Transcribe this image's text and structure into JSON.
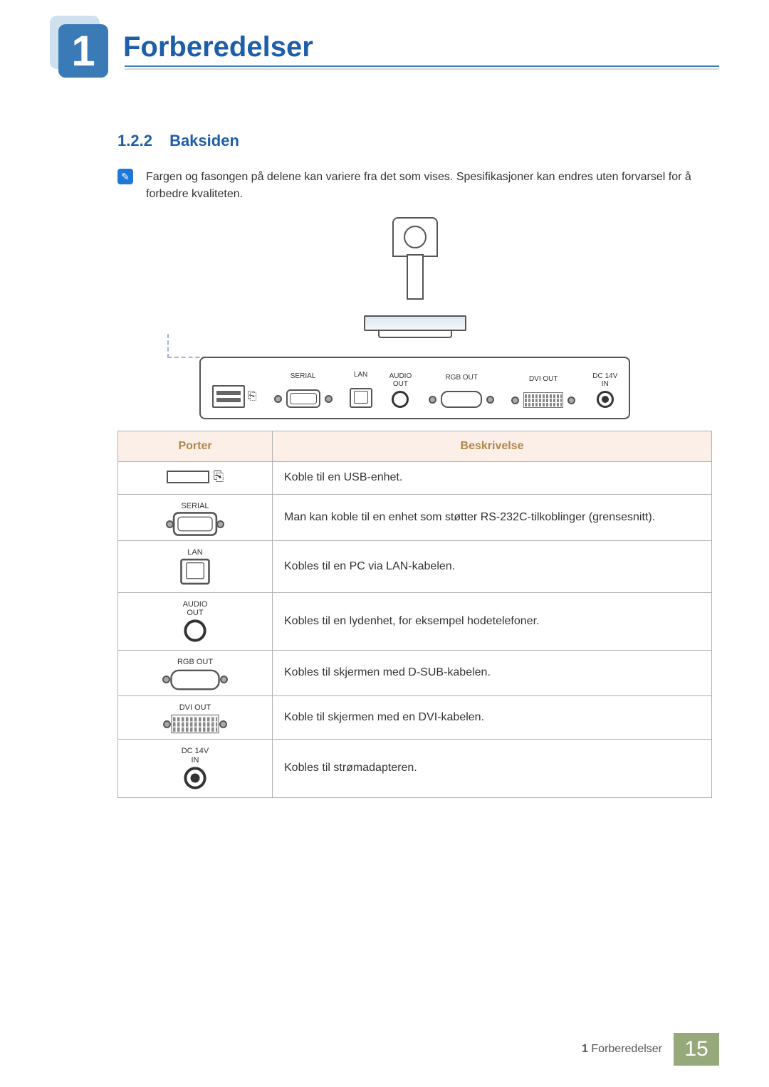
{
  "header": {
    "chapter_number": "1",
    "chapter_title": "Forberedelser"
  },
  "section": {
    "number": "1.2.2",
    "title": "Baksiden"
  },
  "note": {
    "icon_name": "note-icon",
    "text": "Fargen og fasongen på delene kan variere fra det som vises. Spesifikasjoner kan endres uten forvarsel for å forbedre kvaliteten."
  },
  "diagram_labels": {
    "usb": "",
    "serial": "SERIAL",
    "lan": "LAN",
    "audio_out": "AUDIO\nOUT",
    "rgb_out": "RGB OUT",
    "dvi_out": "DVI OUT",
    "dc_in": "DC 14V\nIN"
  },
  "table": {
    "head": {
      "port": "Porter",
      "desc": "Beskrivelse"
    },
    "rows": [
      {
        "caption": "",
        "icon": "usb",
        "desc": "Koble til en USB-enhet."
      },
      {
        "caption": "SERIAL",
        "icon": "serial",
        "desc": "Man kan koble til en enhet som støtter RS-232C-tilkoblinger (grensesnitt)."
      },
      {
        "caption": "LAN",
        "icon": "lan",
        "desc": "Kobles til en PC via LAN-kabelen."
      },
      {
        "caption": "AUDIO\nOUT",
        "icon": "audio",
        "desc": "Kobles til en lydenhet, for eksempel hodetelefoner."
      },
      {
        "caption": "RGB OUT",
        "icon": "rgb",
        "desc": "Kobles til skjermen med D-SUB-kabelen."
      },
      {
        "caption": "DVI OUT",
        "icon": "dvi",
        "desc": "Koble til skjermen med en DVI-kabelen."
      },
      {
        "caption": "DC 14V\nIN",
        "icon": "dc",
        "desc": "Kobles til strømadapteren."
      }
    ]
  },
  "footer": {
    "chapter_ref_num": "1",
    "chapter_ref_title": "Forberedelser",
    "page": "15"
  }
}
